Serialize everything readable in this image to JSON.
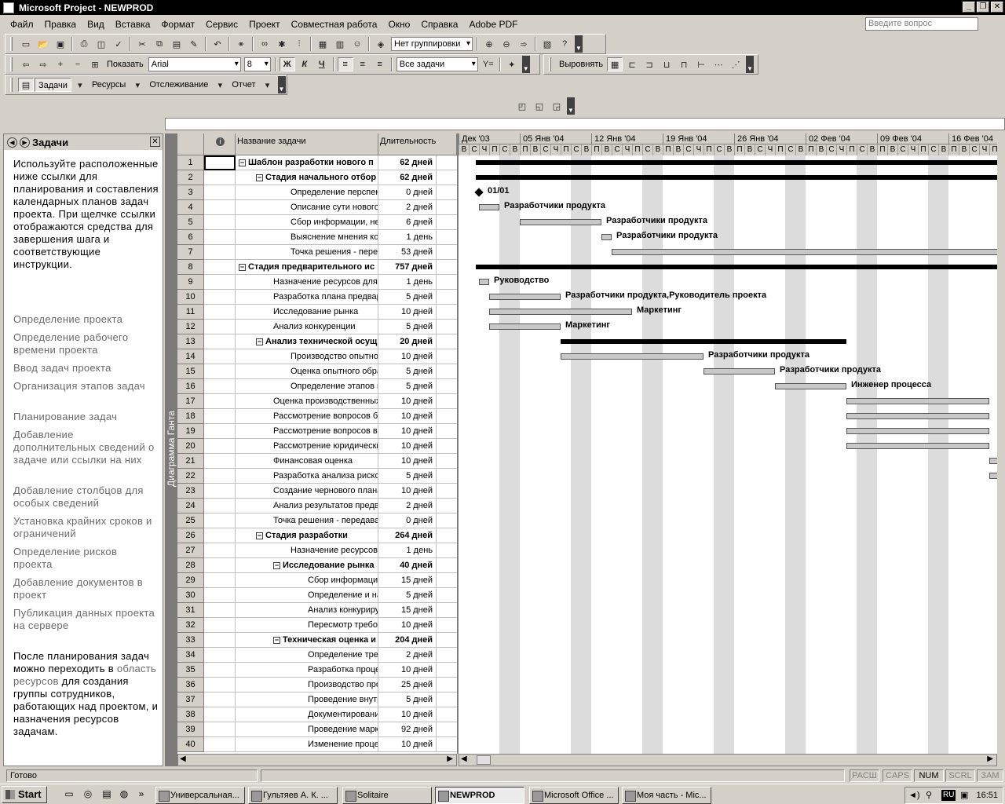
{
  "window": {
    "title": "Microsoft Project - NEWPROD"
  },
  "menu": [
    "Файл",
    "Правка",
    "Вид",
    "Вставка",
    "Формат",
    "Сервис",
    "Проект",
    "Совместная работа",
    "Окно",
    "Справка",
    "Adobe PDF"
  ],
  "ask_placeholder": "Введите вопрос",
  "toolbar": {
    "grouping": "Нет группировки",
    "show_label": "Показать",
    "font": "Arial",
    "font_size": "8",
    "bold": "Ж",
    "italic": "К",
    "underline": "Ч",
    "filter": "Все задачи",
    "align_label": "Выровнять",
    "tasks": "Задачи",
    "resources": "Ресурсы",
    "tracking": "Отслеживание",
    "report": "Отчет"
  },
  "taskpane": {
    "title": "Задачи",
    "intro": "Используйте расположенные ниже ссылки для планирования и составления календарных планов задач проекта. При щелчке ссылки отображаются средства для завершения шага и соответствующие инструкции.",
    "links": [
      "Определение проекта",
      "Определение рабочего времени проекта",
      "Ввод задач проекта",
      "Организация этапов задач",
      "Планирование задач",
      "Добавление дополнительных сведений о задаче или ссылки на них",
      "Добавление столбцов для особых сведений",
      "Установка крайних сроков и ограничений",
      "Определение рисков проекта",
      "Добавление документов в проект",
      "Публикация данных проекта на сервере"
    ],
    "outro_pre": "После планирования задач можно переходить в ",
    "outro_link": "область ресурсов",
    "outro_post": " для создания группы сотрудников, работающих над проектом, и назначения ресурсов задачам."
  },
  "view_bar_label": "Диаграмма Ганта",
  "grid": {
    "headers": {
      "info": "i",
      "name": "Название задачи",
      "duration": "Длительность"
    },
    "rows": [
      {
        "id": "1",
        "name": "Шаблон разработки нового п",
        "dur": "62 дней",
        "level": 0,
        "summary": true
      },
      {
        "id": "2",
        "name": "Стадия начального отбор",
        "dur": "62 дней",
        "level": 1,
        "summary": true
      },
      {
        "id": "3",
        "name": "Определение перспекти",
        "dur": "0 дней",
        "level": 2,
        "summary": false
      },
      {
        "id": "4",
        "name": "Описание сути нового п",
        "dur": "2 дней",
        "level": 2,
        "summary": false
      },
      {
        "id": "5",
        "name": "Сбор информации, необ",
        "dur": "6 дней",
        "level": 2,
        "summary": false
      },
      {
        "id": "6",
        "name": "Выяснение мнения ком",
        "dur": "1 день",
        "level": 2,
        "summary": false
      },
      {
        "id": "7",
        "name": "Точка решения - переда",
        "dur": "53 дней",
        "level": 2,
        "summary": false
      },
      {
        "id": "8",
        "name": "Стадия предварительного ис",
        "dur": "757 дней",
        "level": 0,
        "summary": true
      },
      {
        "id": "9",
        "name": "Назначение ресурсов для п",
        "dur": "1 день",
        "level": 1,
        "summary": false
      },
      {
        "id": "10",
        "name": "Разработка плана предвари",
        "dur": "5 дней",
        "level": 1,
        "summary": false
      },
      {
        "id": "11",
        "name": "Исследование рынка",
        "dur": "10 дней",
        "level": 1,
        "summary": false
      },
      {
        "id": "12",
        "name": "Анализ конкуренции",
        "dur": "5 дней",
        "level": 1,
        "summary": false
      },
      {
        "id": "13",
        "name": "Анализ технической осущ",
        "dur": "20 дней",
        "level": 1,
        "summary": true
      },
      {
        "id": "14",
        "name": "Производство опытног",
        "dur": "10 дней",
        "level": 2,
        "summary": false
      },
      {
        "id": "15",
        "name": "Оценка опытного образ",
        "dur": "5 дней",
        "level": 2,
        "summary": false
      },
      {
        "id": "16",
        "name": "Определение этапов пр",
        "dur": "5 дней",
        "level": 2,
        "summary": false
      },
      {
        "id": "17",
        "name": "Оценка производственных",
        "dur": "10 дней",
        "level": 1,
        "summary": false
      },
      {
        "id": "18",
        "name": "Рассмотрение вопросов бе",
        "dur": "10 дней",
        "level": 1,
        "summary": false
      },
      {
        "id": "19",
        "name": "Рассмотрение вопросов вз",
        "dur": "10 дней",
        "level": 1,
        "summary": false
      },
      {
        "id": "20",
        "name": "Рассмотрение юридических",
        "dur": "10 дней",
        "level": 1,
        "summary": false
      },
      {
        "id": "21",
        "name": "Финансовая оценка",
        "dur": "10 дней",
        "level": 1,
        "summary": false
      },
      {
        "id": "22",
        "name": "Разработка анализа рисков",
        "dur": "5 дней",
        "level": 1,
        "summary": false
      },
      {
        "id": "23",
        "name": "Создание чернового плана ,",
        "dur": "10 дней",
        "level": 1,
        "summary": false
      },
      {
        "id": "24",
        "name": "Анализ результатов предва",
        "dur": "2 дней",
        "level": 1,
        "summary": false
      },
      {
        "id": "25",
        "name": "Точка решения - передават",
        "dur": "0 дней",
        "level": 1,
        "summary": false
      },
      {
        "id": "26",
        "name": "Стадия разработки",
        "dur": "264 дней",
        "level": 1,
        "summary": true
      },
      {
        "id": "27",
        "name": "Назначение ресурсов г",
        "dur": "1 день",
        "level": 2,
        "summary": false
      },
      {
        "id": "28",
        "name": "Исследование рынка",
        "dur": "40 дней",
        "level": 2,
        "summary": true
      },
      {
        "id": "29",
        "name": "Сбор информации (",
        "dur": "15 дней",
        "level": 3,
        "summary": false
      },
      {
        "id": "30",
        "name": "Определение и нал",
        "dur": "5 дней",
        "level": 3,
        "summary": false
      },
      {
        "id": "31",
        "name": "Анализ конкурирук",
        "dur": "15 дней",
        "level": 3,
        "summary": false
      },
      {
        "id": "32",
        "name": "Пересмотр требов",
        "dur": "10 дней",
        "level": 3,
        "summary": false
      },
      {
        "id": "33",
        "name": "Техническая оценка и",
        "dur": "204 дней",
        "level": 2,
        "summary": true
      },
      {
        "id": "34",
        "name": "Определение требу",
        "dur": "2 дней",
        "level": 3,
        "summary": false
      },
      {
        "id": "35",
        "name": "Разработка процес",
        "dur": "10 дней",
        "level": 3,
        "summary": false
      },
      {
        "id": "36",
        "name": "Производство прот",
        "dur": "25 дней",
        "level": 3,
        "summary": false
      },
      {
        "id": "37",
        "name": "Проведение внутр",
        "dur": "5 дней",
        "level": 3,
        "summary": false
      },
      {
        "id": "38",
        "name": "Документирование",
        "dur": "10 дней",
        "level": 3,
        "summary": false
      },
      {
        "id": "39",
        "name": "Проведение марке",
        "dur": "92 дней",
        "level": 3,
        "summary": false
      },
      {
        "id": "40",
        "name": "Изменение процес",
        "dur": "10 дней",
        "level": 3,
        "summary": false
      }
    ]
  },
  "gantt": {
    "weeks": [
      "Дек '03",
      "05 Янв '04",
      "12 Янв '04",
      "19 Янв '04",
      "26 Янв '04",
      "02 Фев '04",
      "09 Фев '04",
      "16 Фев '04"
    ],
    "day_letters": [
      "В",
      "С",
      "Ч",
      "П",
      "С",
      "В",
      "П"
    ],
    "labels": {
      "milestone": "01/01",
      "r4": "Разработчики продукта",
      "r5": "Разработчики продукта",
      "r6": "Разработчики продукта",
      "r9": "Руководство",
      "r10": "Разработчики продукта,Руководитель проекта",
      "r11": "Маркетинг",
      "r12": "Маркетинг",
      "r14": "Разработчики продукта",
      "r15": "Разработчики продукта",
      "r16": "Инженер процесса"
    }
  },
  "status": {
    "ready": "Готово",
    "keys": [
      "РАСШ",
      "CAPS",
      "NUM",
      "SCRL",
      "ЗАМ"
    ]
  },
  "taskbar": {
    "start": "Start",
    "buttons": [
      "Универсальная...",
      "Гультяев А. К. ...",
      "Solitaire",
      "NEWPROD",
      "Microsoft Office ...",
      "Моя часть - Mic..."
    ],
    "lang": "RU",
    "time": "16:51"
  }
}
